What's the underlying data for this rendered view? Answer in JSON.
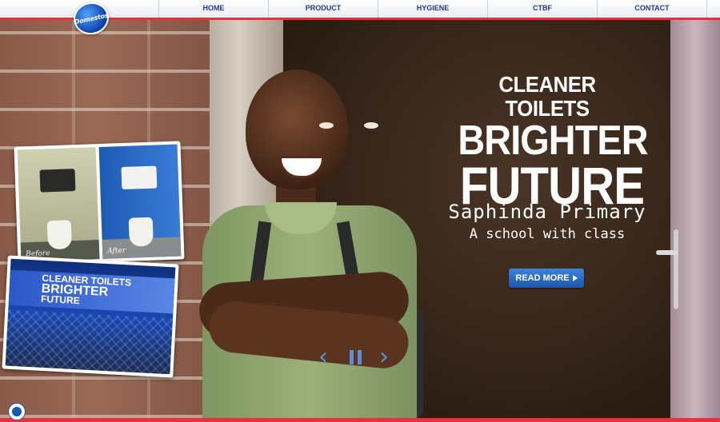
{
  "brand": {
    "logo_text": "Domestos"
  },
  "nav": {
    "items": [
      {
        "label": "HOME"
      },
      {
        "label": "PRODUCT"
      },
      {
        "label": "HYGIENE"
      },
      {
        "label": "CTBF"
      },
      {
        "label": "CONTACT"
      }
    ]
  },
  "hero": {
    "headline_1": "CLEANER TOILETS",
    "headline_2": "BRIGHTER",
    "headline_3": "FUTURE",
    "school_name": "Saphinda Primary",
    "school_tagline": "A school with class",
    "cta_label": "READ MORE"
  },
  "photos": {
    "before_caption": "Before",
    "after_caption": "After",
    "banner_line1": "CLEANER TOILETS",
    "banner_line2": "BRIGHTER",
    "banner_line3": "FUTURE"
  },
  "colors": {
    "accent_red": "#e8303f",
    "nav_blue": "#1c3a8c",
    "cta_blue": "#1b58b0"
  },
  "icons": {
    "prev": "chevron-left-icon",
    "pause": "pause-icon",
    "next": "chevron-right-icon"
  }
}
